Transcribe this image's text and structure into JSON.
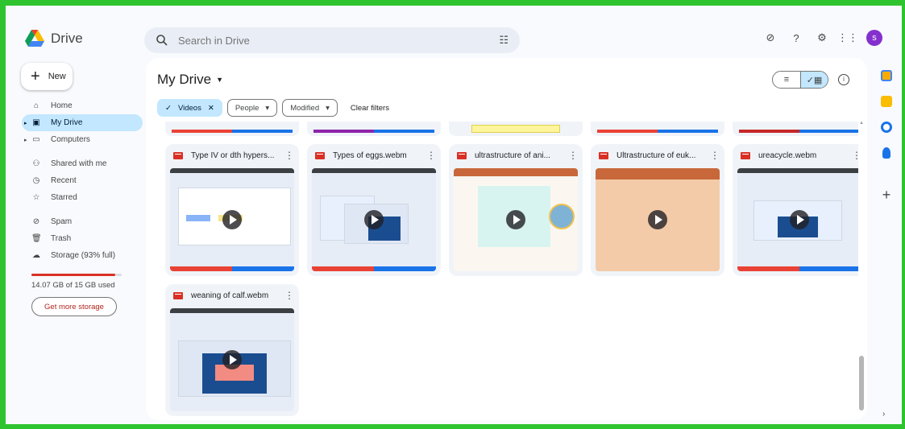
{
  "app": {
    "name": "Drive"
  },
  "search": {
    "placeholder": "Search in Drive"
  },
  "header": {
    "avatar_initial": "s",
    "avatar_color": "#8430ce"
  },
  "new_button": {
    "label": "New"
  },
  "nav": {
    "home": "Home",
    "my_drive": "My Drive",
    "computers": "Computers",
    "shared": "Shared with me",
    "recent": "Recent",
    "starred": "Starred",
    "spam": "Spam",
    "trash": "Trash",
    "storage": "Storage (93% full)"
  },
  "storage": {
    "used_text": "14.07 GB of 15 GB used",
    "fraction": 0.93,
    "cta": "Get more storage"
  },
  "main": {
    "title": "My Drive",
    "filters": {
      "type": "Videos",
      "people": "People",
      "modified": "Modified",
      "clear": "Clear filters"
    }
  },
  "files": [
    {
      "name": "Type IV or dth hypers..."
    },
    {
      "name": "Types of eggs.webm"
    },
    {
      "name": "ultrastructure of ani..."
    },
    {
      "name": "Ultrastructure of euk..."
    },
    {
      "name": "ureacycle.webm"
    },
    {
      "name": "weaning of calf.webm"
    }
  ],
  "colors": {
    "accent": "#c2e7ff",
    "frame": "#2fc42f",
    "video_icon": "#d93025"
  }
}
